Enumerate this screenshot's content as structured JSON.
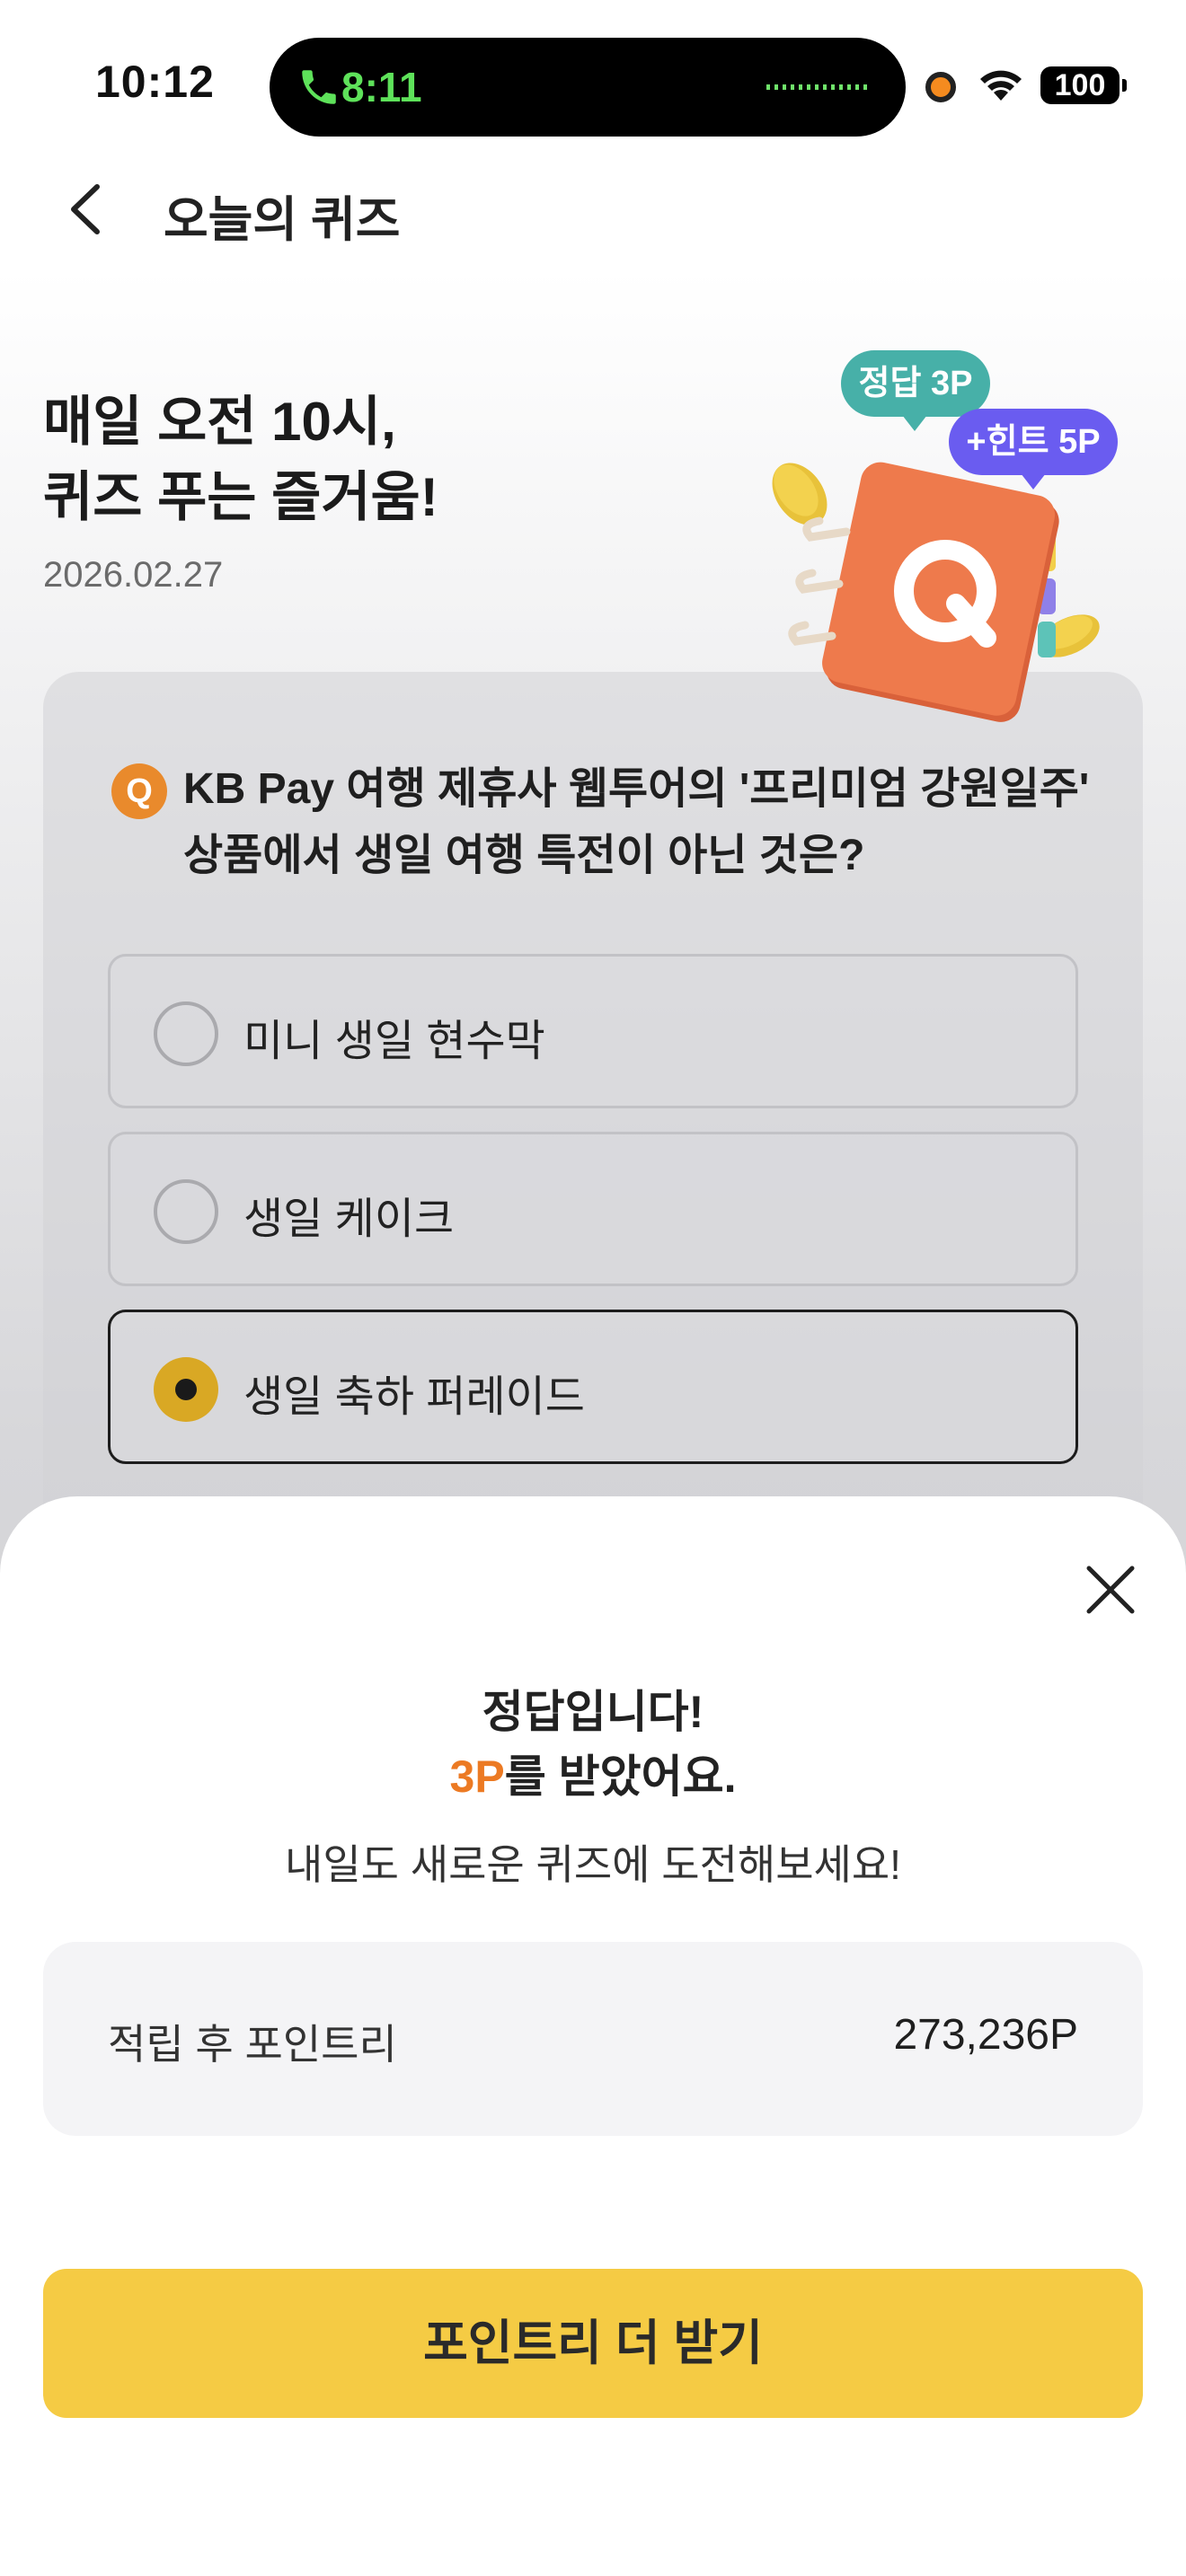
{
  "status_bar": {
    "time": "10:12",
    "call_time": "8:11",
    "battery": "100"
  },
  "header": {
    "title": "오늘의 퀴즈",
    "back_icon": "chevron-left-icon"
  },
  "hero": {
    "headline_line1": "매일 오전 10시,",
    "headline_line2": "퀴즈 푸는 즐거움!",
    "date": "2026.02.27",
    "bubble_answer": "정답 3P",
    "bubble_hint": "+힌트 5P",
    "illustration_letter": "Q"
  },
  "quiz": {
    "badge": "Q",
    "question": "KB Pay 여행 제휴사 웹투어의 '프리미엄 강원일주' 상품에서 생일 여행 특전이 아닌 것은?",
    "options": [
      {
        "label": "미니 생일 현수막",
        "selected": false
      },
      {
        "label": "생일 케이크",
        "selected": false
      },
      {
        "label": "생일 축하 퍼레이드",
        "selected": true
      }
    ]
  },
  "result_sheet": {
    "title": "정답입니다!",
    "points_earned": "3P",
    "points_suffix": "를 받았어요.",
    "subtitle": "내일도 새로운 퀴즈에 도전해보세요!",
    "balance_label": "적립 후 포인트리",
    "balance_value": "273,236P",
    "cta_label": "포인트리 더 받기"
  },
  "colors": {
    "cta": "#f5cb44",
    "accent_orange": "#ec7a23",
    "bubble_answer": "#47b0a8",
    "bubble_hint": "#6a5cf0",
    "radio_selected": "#d9a824"
  }
}
